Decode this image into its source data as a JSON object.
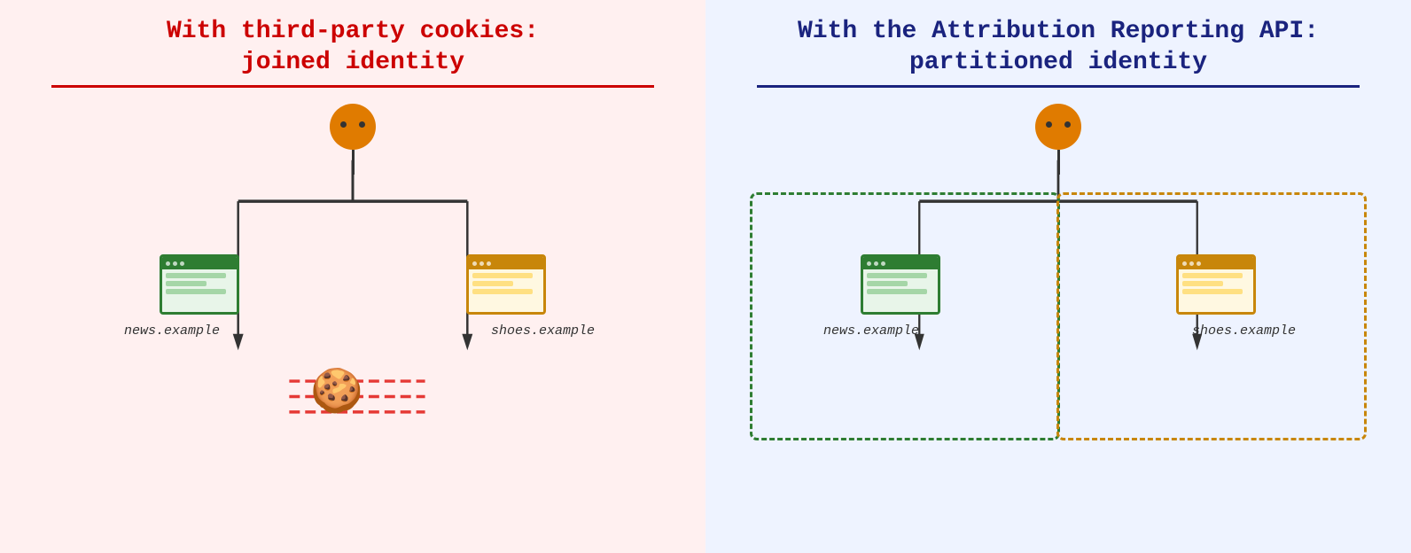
{
  "left_panel": {
    "title_line1": "With third-party cookies:",
    "title_line2": "joined identity",
    "bg_color": "#fff0f0",
    "title_color": "#cc0000",
    "divider_color": "#cc0000",
    "site_left": "news.example",
    "site_right": "shoes.example"
  },
  "right_panel": {
    "title_line1": "With the Attribution Reporting API:",
    "title_line2": "partitioned identity",
    "bg_color": "#eef3ff",
    "title_color": "#1a237e",
    "divider_color": "#1a237e",
    "site_left": "news.example",
    "site_right": "shoes.example"
  },
  "icons": {
    "cookie": "🍪"
  }
}
